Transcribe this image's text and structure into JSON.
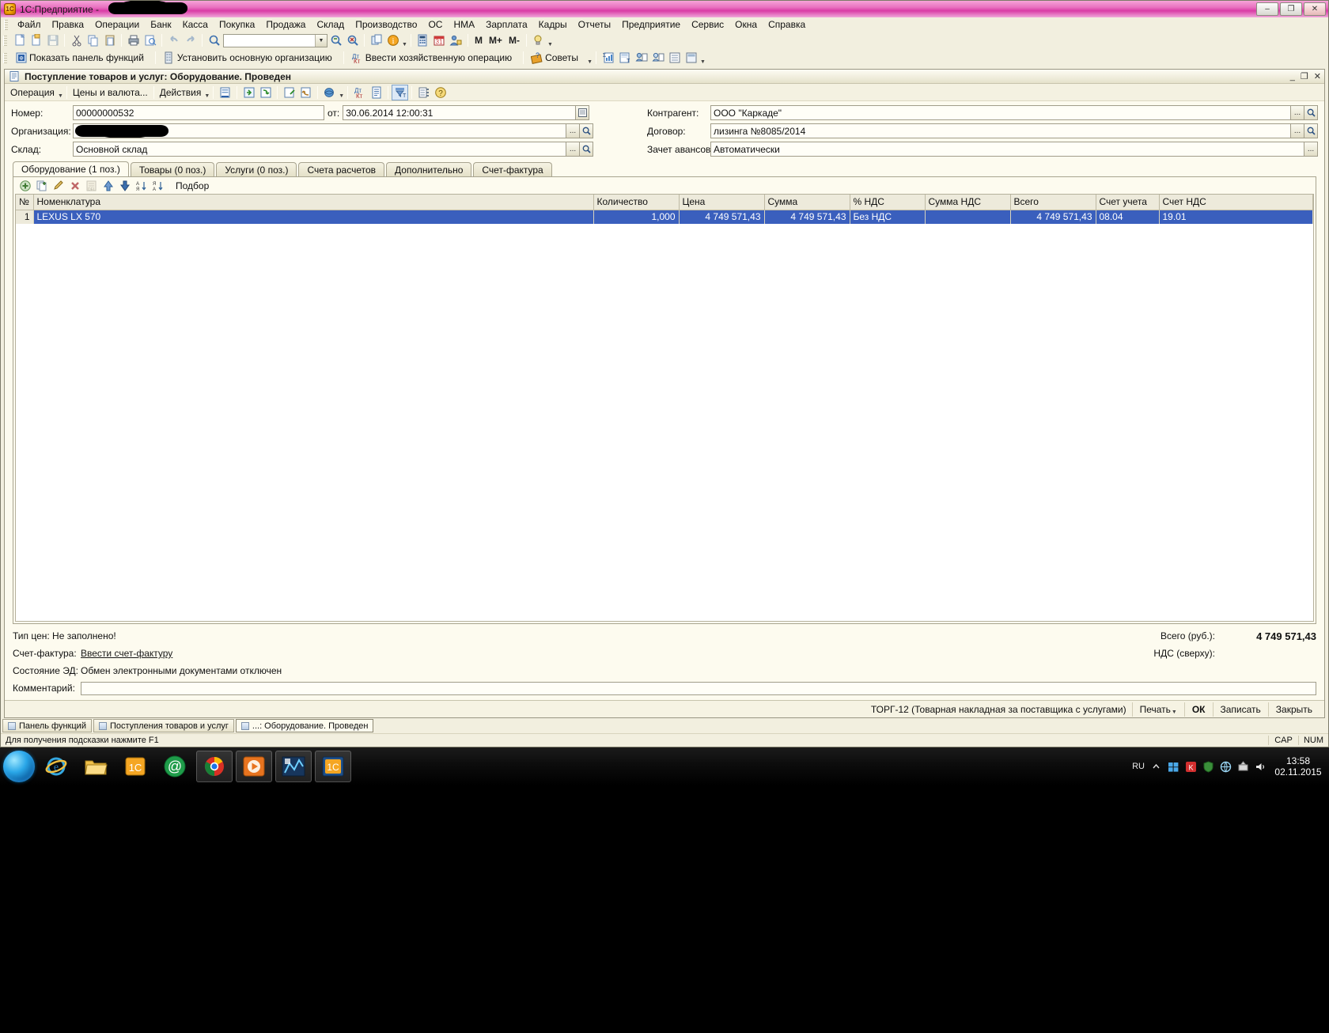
{
  "window": {
    "title": "1С:Предприятие - ",
    "icon": "1c-icon",
    "buttons": {
      "minimize": "–",
      "maximize": "❐",
      "close": "✕"
    }
  },
  "menubar": [
    {
      "label": "Файл"
    },
    {
      "label": "Правка"
    },
    {
      "label": "Операции"
    },
    {
      "label": "Банк"
    },
    {
      "label": "Касса"
    },
    {
      "label": "Покупка"
    },
    {
      "label": "Продажа"
    },
    {
      "label": "Склад"
    },
    {
      "label": "Производство"
    },
    {
      "label": "ОС"
    },
    {
      "label": "НМА"
    },
    {
      "label": "Зарплата"
    },
    {
      "label": "Кадры"
    },
    {
      "label": "Отчеты"
    },
    {
      "label": "Предприятие"
    },
    {
      "label": "Сервис"
    },
    {
      "label": "Окна"
    },
    {
      "label": "Справка"
    }
  ],
  "toolbar_main": {
    "combo_value": "",
    "m_buttons": [
      "M",
      "M+",
      "M-"
    ],
    "icons": [
      "new-document-icon",
      "open-document-icon",
      "save-icon",
      "cut-icon",
      "copy-icon",
      "paste-icon",
      "print-icon",
      "print-preview-icon",
      "undo-icon",
      "redo-icon",
      "find-icon",
      "search-find-next-icon",
      "search-cancel-icon",
      "copy-window-icon",
      "info-icon",
      "calculator-icon",
      "calendar-icon",
      "user-switch-icon"
    ]
  },
  "toolbar_second": {
    "items": [
      {
        "label": "Показать панель функций",
        "icon": "functions-panel-icon"
      },
      {
        "label": "Установить основную организацию",
        "icon": "organization-icon"
      },
      {
        "label": "Ввести хозяйственную операцию",
        "icon": "business-operation-icon"
      },
      {
        "label": "Советы",
        "icon": "tips-icon"
      }
    ],
    "extra_icons": [
      "report-icon",
      "report-filter-icon",
      "contact-icon",
      "contact-list-icon",
      "list-icon"
    ]
  },
  "document": {
    "title": "Поступление товаров и услуг: Оборудование. Проведен",
    "icon": "document-icon",
    "window_buttons": {
      "minimize": "_",
      "restore": "❐",
      "close": "✕"
    },
    "toolbar": {
      "operation_label": "Операция",
      "prices_label": "Цены и валюта...",
      "actions_label": "Действия",
      "icons": [
        "post-document-icon",
        "post-and-close-icon",
        "unpost-icon",
        "record-icon",
        "refresh-icon",
        "print-dropdown-icon",
        "dt-kt-icon",
        "register-icon",
        "filter-icon",
        "structure-icon",
        "help-icon"
      ]
    },
    "fields": {
      "number_label": "Номер:",
      "number_value": "00000000532",
      "date_label": "от:",
      "date_value": "30.06.2014 12:00:31",
      "organization_label": "Организация:",
      "organization_value": "",
      "warehouse_label": "Склад:",
      "warehouse_value": "Основной склад",
      "counterparty_label": "Контрагент:",
      "counterparty_value": "ООО \"Каркаде\"",
      "contract_label": "Договор:",
      "contract_value": "лизинга №8085/2014",
      "advance_label": "Зачет авансов:",
      "advance_value": "Автоматически"
    },
    "tabs": [
      {
        "label": "Оборудование (1 поз.)",
        "active": true
      },
      {
        "label": "Товары (0 поз.)",
        "active": false
      },
      {
        "label": "Услуги (0 поз.)",
        "active": false
      },
      {
        "label": "Счета расчетов",
        "active": false
      },
      {
        "label": "Дополнительно",
        "active": false
      },
      {
        "label": "Счет-фактура",
        "active": false
      }
    ],
    "table_toolbar": {
      "select_label": "Подбор",
      "icons": [
        "add-row-icon",
        "copy-row-icon",
        "edit-row-icon",
        "delete-row-icon",
        "delete-direct-icon",
        "move-up-icon",
        "move-down-icon",
        "sort-asc-icon",
        "sort-desc-icon"
      ]
    },
    "table": {
      "columns": [
        "№",
        "Номенклатура",
        "Количество",
        "Цена",
        "Сумма",
        "% НДС",
        "Сумма НДС",
        "Всего",
        "Счет учета",
        "Счет НДС"
      ],
      "rows": [
        {
          "num": "1",
          "nomenclature": "LEXUS LX 570",
          "quantity": "1,000",
          "price": "4 749 571,43",
          "sum": "4 749 571,43",
          "vat_rate": "Без НДС",
          "vat_sum": "",
          "total": "4 749 571,43",
          "account": "08.04",
          "vat_account": "19.01",
          "selected": true
        }
      ]
    },
    "footer": {
      "price_type": "Тип цен: Не заполнено!",
      "invoice_label": "Счет-фактура:",
      "invoice_link": "Ввести счет-фактуру",
      "ed_state_label": "Состояние ЭД:",
      "ed_state_value": "Обмен электронными документами отключен",
      "comment_label": "Комментарий:",
      "comment_value": "",
      "total_label": "Всего (руб.):",
      "total_value": "4 749 571,43",
      "vat_label": "НДС (сверху):",
      "vat_value": ""
    },
    "actions": {
      "print_form": "ТОРГ-12 (Товарная накладная за поставщика с услугами)",
      "print": "Печать",
      "ok": "ОК",
      "write": "Записать",
      "close": "Закрыть"
    }
  },
  "mdi_tabs": [
    {
      "label": "Панель функций",
      "active": false,
      "icon": "panel-icon"
    },
    {
      "label": "Поступления товаров и услуг",
      "active": false,
      "icon": "list-window-icon"
    },
    {
      "label": "...: Оборудование. Проведен",
      "active": true,
      "icon": "document-window-icon"
    }
  ],
  "statusbar": {
    "hint": "Для получения подсказки нажмите F1",
    "cap": "CAP",
    "num": "NUM"
  },
  "taskbar": {
    "start": "start-orb",
    "apps": [
      {
        "name": "internet-explorer-icon"
      },
      {
        "name": "file-explorer-icon"
      },
      {
        "name": "1c-icon"
      },
      {
        "name": "mail-at-icon"
      },
      {
        "name": "chrome-icon"
      },
      {
        "name": "media-player-icon"
      },
      {
        "name": "graph-app-icon"
      },
      {
        "name": "1c-enterprise-icon"
      }
    ],
    "tray": {
      "language": "RU",
      "icons": [
        "chevron-up-icon",
        "windows-flag-icon",
        "kaspersky-icon",
        "shield-icon",
        "network-icon",
        "usb-eject-icon",
        "volume-icon"
      ],
      "time": "13:58",
      "date": "02.11.2015"
    }
  },
  "colors": {
    "app_bg": "#f2efdf",
    "accent_selection": "#3a5fbd",
    "title_gradient": "#e870bf",
    "field_bg": "#fffef7"
  }
}
